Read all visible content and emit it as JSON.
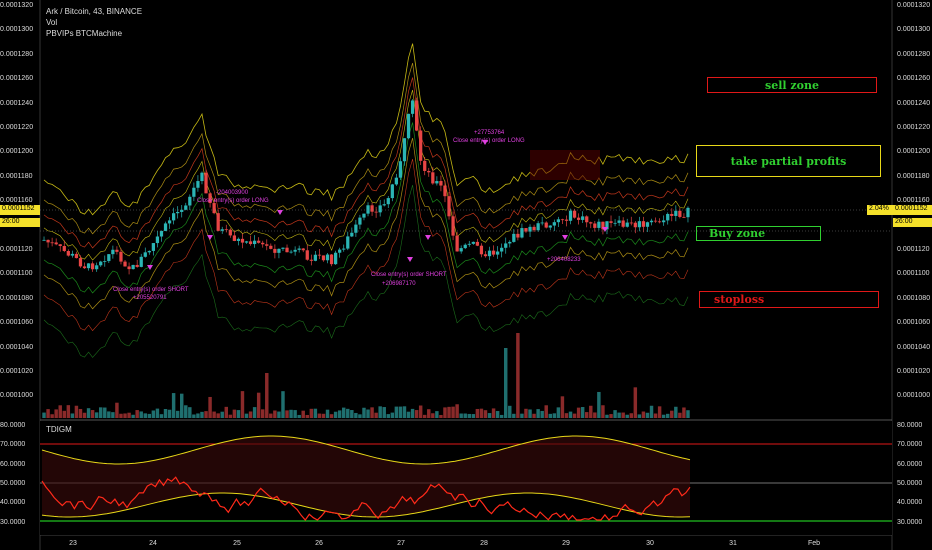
{
  "header": {
    "symbol_line": "Ark / Bitcoin, 43, BINANCE",
    "vol_label": "Vol",
    "indicator_label": "PBVIPs BTCMachine"
  },
  "price_axis": {
    "ticks": [
      "0.0001320",
      "0.0001300",
      "0.0001280",
      "0.0001260",
      "0.0001240",
      "0.0001220",
      "0.0001200",
      "0.0001180",
      "0.0001160",
      "0.0001140",
      "0.0001120",
      "0.0001100",
      "0.0001080",
      "0.0001060",
      "0.0001040",
      "0.0001020",
      "0.0001000"
    ],
    "current_price": "0.0001152",
    "current_change": "2.04%",
    "countdown": "26:00"
  },
  "oscillator": {
    "label": "TDIGM",
    "ticks": [
      "80.0000",
      "70.0000",
      "60.0000",
      "50.0000",
      "40.0000",
      "30.0000"
    ]
  },
  "dates": [
    "23",
    "24",
    "25",
    "26",
    "27",
    "28",
    "29",
    "30",
    "31",
    "Feb"
  ],
  "zones": {
    "sell": "sell zone",
    "take_profit": "take partial profits",
    "buy": "Buy zone",
    "stop": "stoploss"
  },
  "trade_annotations": [
    "Close entry(s) order SHORT",
    "+205520791",
    "-204003900",
    "Close entry(s) order LONG",
    "Close entry(s) order SHORT",
    "+206987170",
    "+27753764",
    "Close entry(s) order LONG",
    "+206408233"
  ],
  "colors": {
    "sell_zone": "#e01818",
    "take_profit": "#e8d818",
    "buy_zone": "#30d030",
    "stoploss": "#e01818",
    "zone_text_sell": "#30d030",
    "zone_text_stop": "#e01818",
    "price_tag": "#f5e12a",
    "rsi_line": "#ff2a1a",
    "band_line": "#e8d818",
    "osc_high": "#e01818",
    "osc_low": "#20c020"
  }
}
